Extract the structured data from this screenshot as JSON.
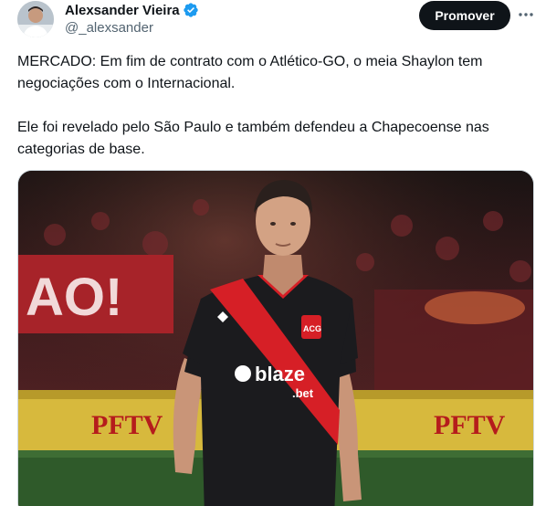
{
  "author": {
    "display_name": "Alexsander Vieira",
    "handle": "@_alexsander",
    "verified_icon": "verified-badge-icon"
  },
  "actions": {
    "promote_label": "Promover",
    "more_icon": "more-options-icon"
  },
  "tweet": {
    "paragraphs": [
      "MERCADO: Em fim de contrato com o Atlético-GO, o meia Shaylon tem negociações com o Internacional.",
      "Ele foi revelado pelo São Paulo e também defendeu a Chapecoense nas categorias de base."
    ]
  },
  "media": {
    "banner_text": "AO!",
    "ad_board_text": "PFTV",
    "jersey_sponsor": "blaze",
    "jersey_sponsor_sub": ".bet",
    "crest_text": "ACG"
  },
  "colors": {
    "accent": "#1d9bf0",
    "text": "#0f1419",
    "muted": "#536471",
    "button_bg": "#0f1419",
    "jersey_red": "#d61f26",
    "jersey_black": "#1b1b1e"
  }
}
